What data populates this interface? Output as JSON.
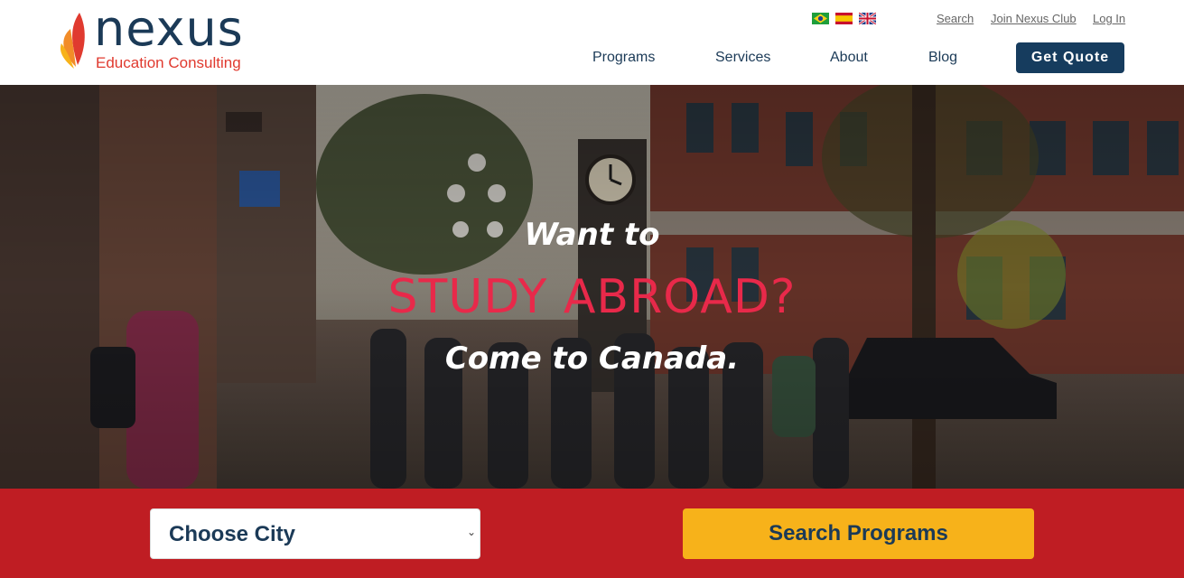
{
  "brand": {
    "name": "nexus",
    "tagline": "Education Consulting"
  },
  "top_links": {
    "search": "Search",
    "join": "Join Nexus Club",
    "login": "Log In"
  },
  "nav": [
    "Programs",
    "Services",
    "About",
    "Blog"
  ],
  "quote_button": "Get Quote",
  "hero": {
    "line1": "Want to",
    "line2": "STUDY ABROAD?",
    "line3": "Come to Canada."
  },
  "search": {
    "city_placeholder": "Choose City",
    "button": "Search Programs"
  },
  "colors": {
    "navy": "#163c5e",
    "red": "#bf1d23",
    "accent_red": "#e8294a",
    "yellow": "#f7b21a",
    "leaf_orange": "#f28c28"
  },
  "icons": [
    "flag-brazil-icon",
    "flag-spain-icon",
    "flag-uk-icon",
    "leaf-logo-icon",
    "chevron-down-icon"
  ]
}
